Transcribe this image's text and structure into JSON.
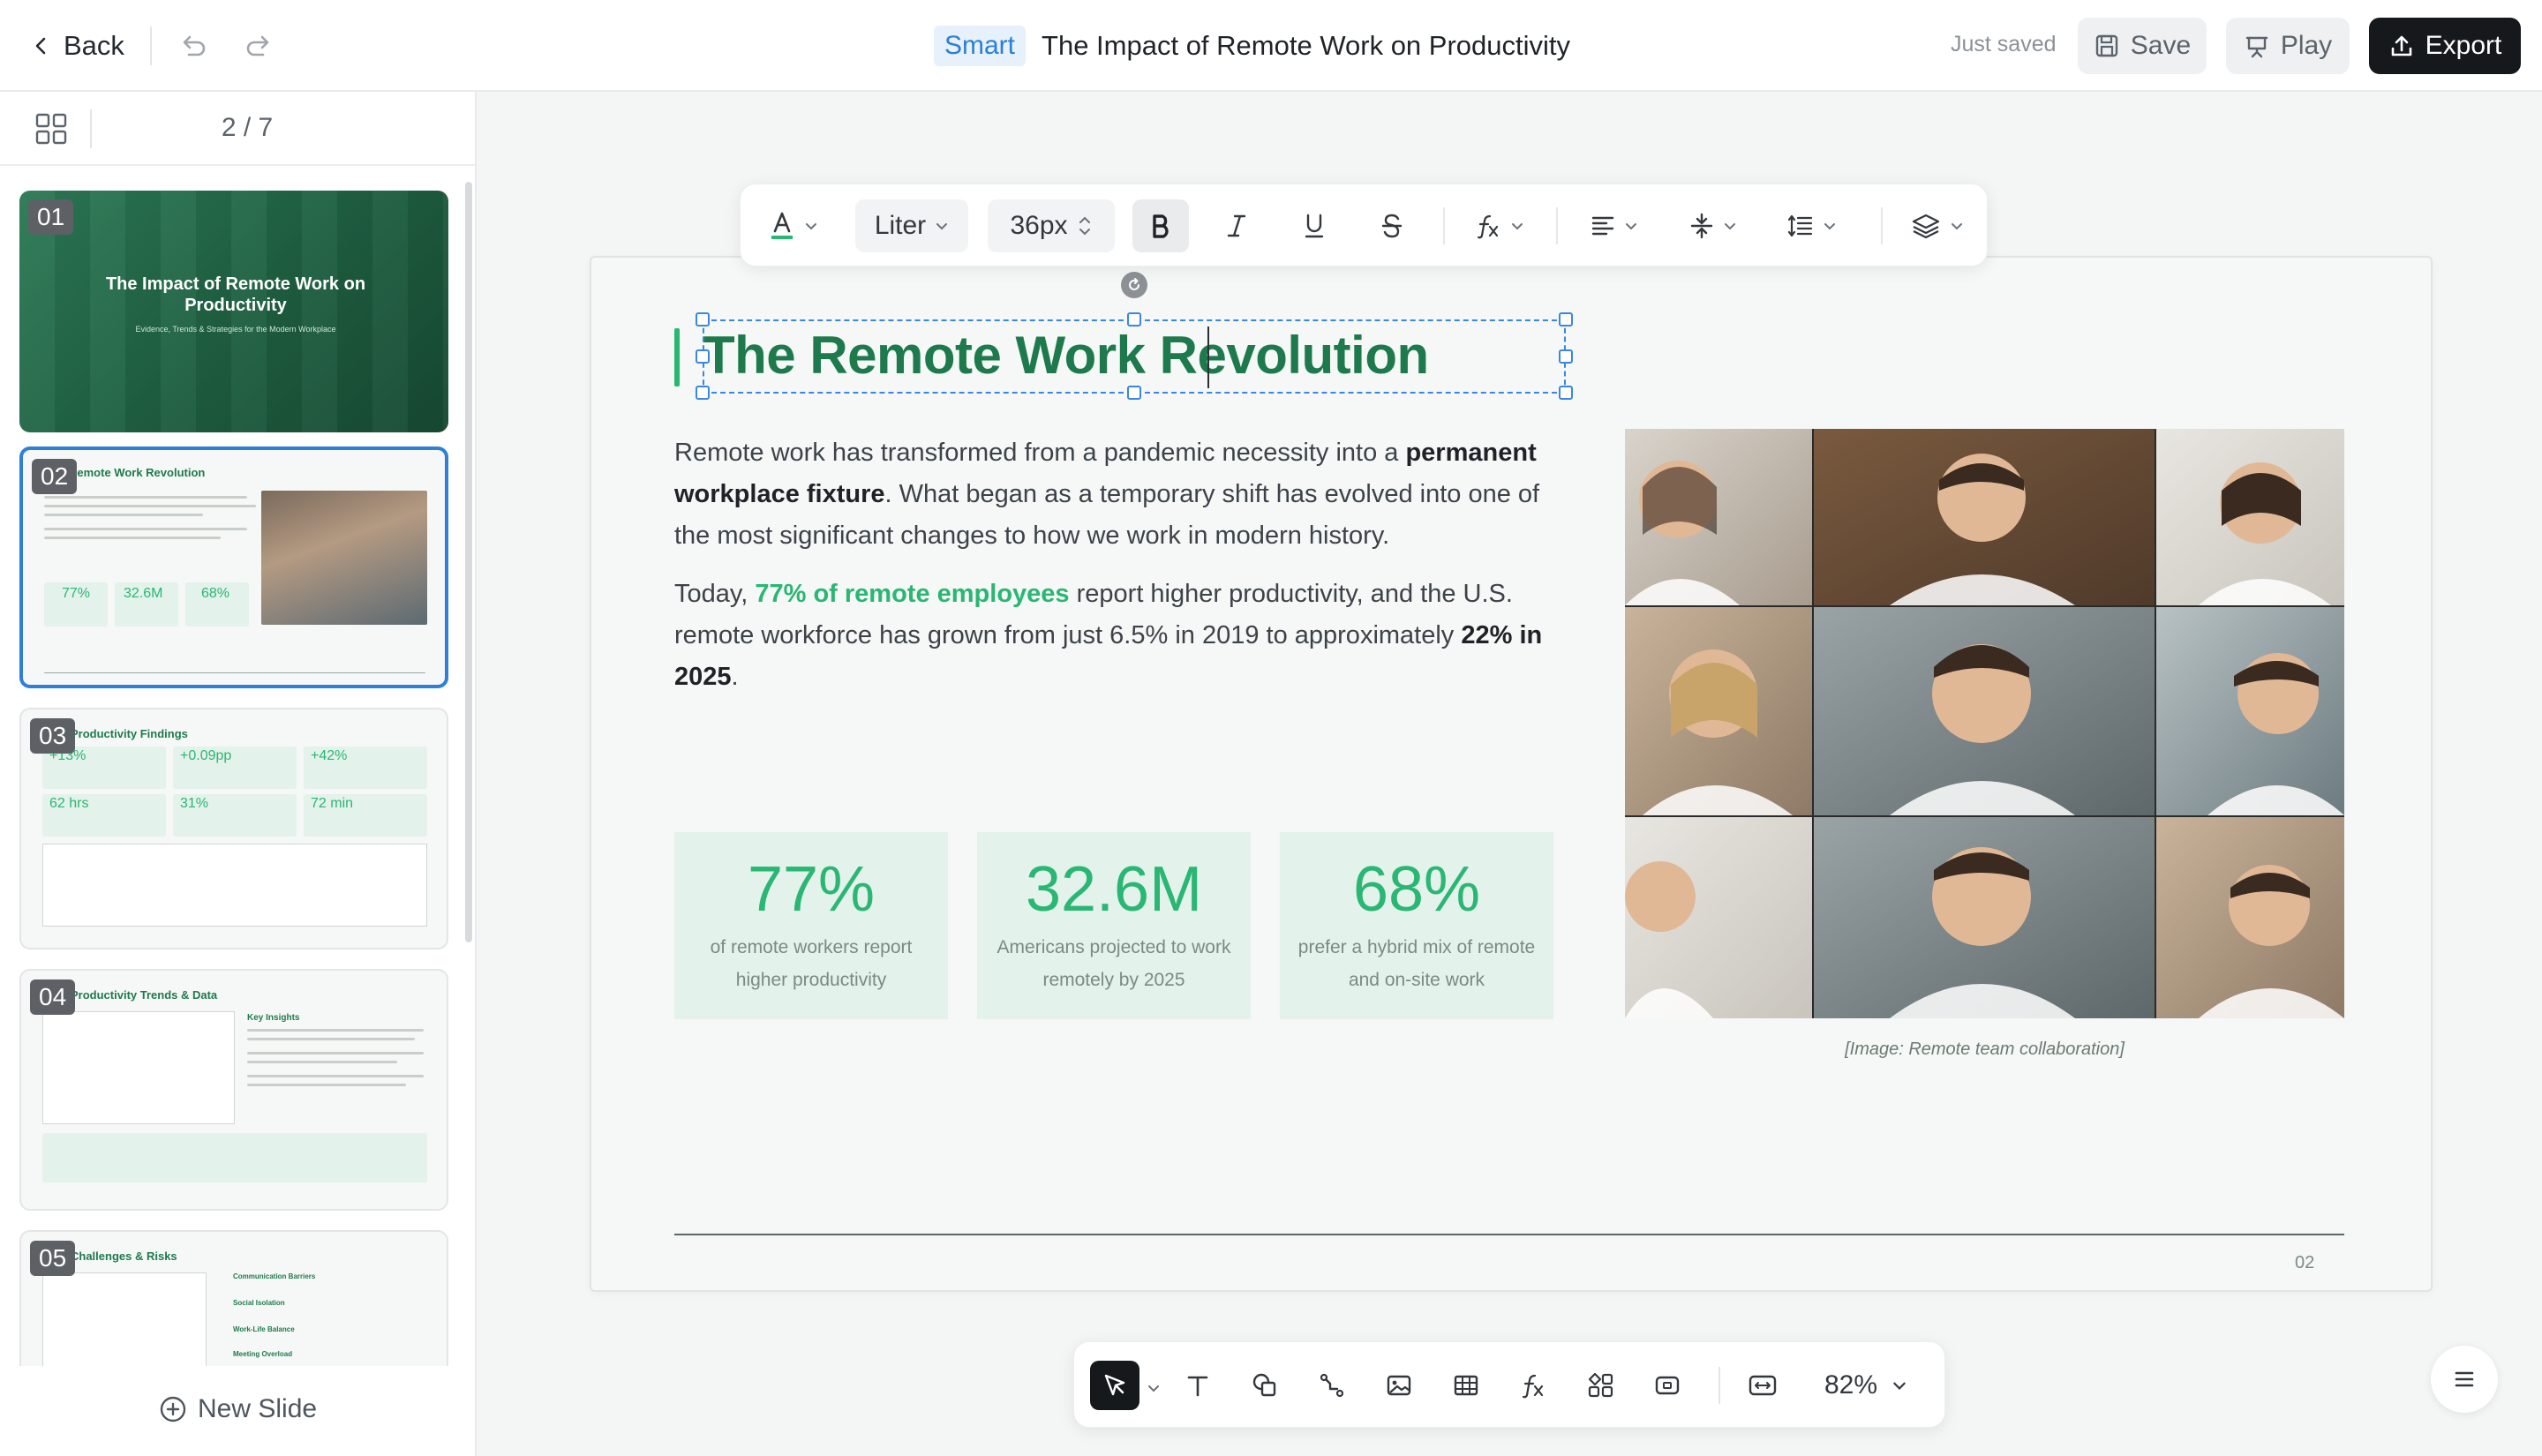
{
  "topbar": {
    "back_label": "Back",
    "smart_badge": "Smart",
    "doc_title": "The Impact of Remote Work on Productivity",
    "save_status": "Just saved",
    "save_label": "Save",
    "play_label": "Play",
    "export_label": "Export"
  },
  "sidebar": {
    "page_indicator": "2 / 7",
    "new_slide_label": "New Slide",
    "thumbs": [
      {
        "num": "01",
        "title": "The Impact of Remote Work on Productivity",
        "subtitle": "Evidence, Trends & Strategies for the Modern Workplace"
      },
      {
        "num": "02",
        "title": "Remote Work Revolution",
        "stats": [
          "77%",
          "32.6M",
          "68%"
        ]
      },
      {
        "num": "03",
        "title": "Productivity Findings",
        "stats": [
          "+13%",
          "+0.09pp",
          "+42%",
          "62 hrs",
          "31%",
          "72 min"
        ]
      },
      {
        "num": "04",
        "title": "Productivity Trends & Data",
        "side_heading": "Key Insights"
      },
      {
        "num": "05",
        "title": "Challenges & Risks",
        "side_items": [
          "Communication Barriers",
          "Social Isolation",
          "Work-Life Balance",
          "Meeting Overload"
        ]
      }
    ]
  },
  "format_toolbar": {
    "font_family": "Liter",
    "font_size": "36px"
  },
  "slide": {
    "title": "The Remote Work Revolution",
    "para1": {
      "before": "Remote work has transformed from a pandemic necessity into a ",
      "bold": "permanent workplace fixture",
      "after": ". What began as a temporary shift has evolved into one of the most significant changes to how we work in modern history."
    },
    "para2": {
      "before": "Today, ",
      "highlight": "77% of remote employees",
      "middle": " report higher productivity, and the U.S. remote workforce has grown from just 6.5% in 2019 to approximately ",
      "bold": "22% in 2025",
      "after": "."
    },
    "stats": [
      {
        "value": "77%",
        "label": "of remote workers report higher productivity"
      },
      {
        "value": "32.6M",
        "label": "Americans projected to work remotely by 2025"
      },
      {
        "value": "68%",
        "label": "prefer a hybrid mix of remote and on-site work"
      }
    ],
    "image_caption": "[Image: Remote team collaboration]",
    "page_number": "02"
  },
  "bottom_toolbar": {
    "zoom": "82%"
  },
  "colors": {
    "accent_green": "#2ab673",
    "title_green": "#1e7a4d",
    "selection_blue": "#3b86e0"
  }
}
